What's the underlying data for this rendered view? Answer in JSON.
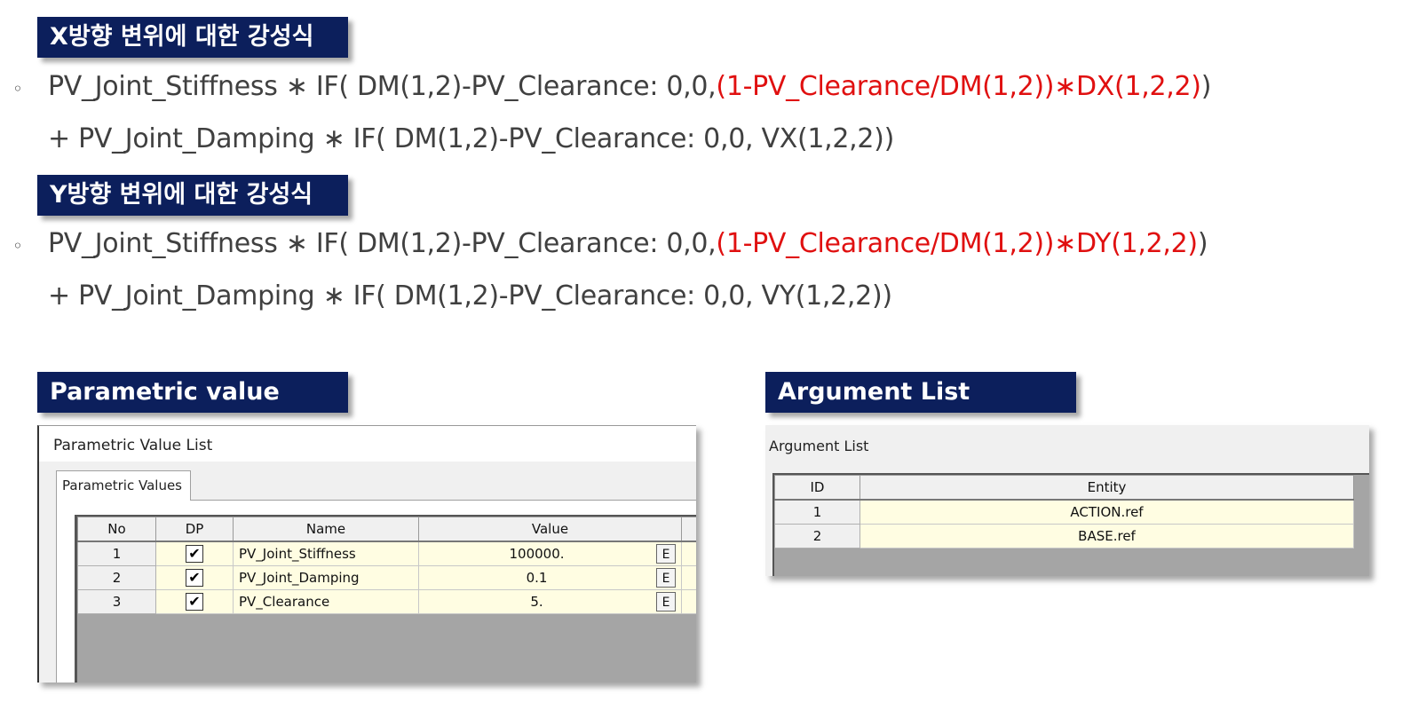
{
  "sections": {
    "x_header": "X방향 변위에 대한 강성식",
    "y_header": "Y방향 변위에 대한 강성식",
    "param_header": "Parametric value",
    "arg_header": "Argument List"
  },
  "equations": {
    "bullet": "◦",
    "x_line1_black": "PV_Joint_Stiffness ∗ IF( DM(1,2)-PV_Clearance: 0,0,",
    "x_line1_red": "(1-PV_Clearance/DM(1,2))∗DX(1,2,2)",
    "x_line1_end": ")",
    "x_line2": "+ PV_Joint_Damping ∗ IF( DM(1,2)-PV_Clearance: 0,0, VX(1,2,2))",
    "y_line1_black": "PV_Joint_Stiffness ∗ IF( DM(1,2)-PV_Clearance: 0,0,",
    "y_line1_red": "(1-PV_Clearance/DM(1,2))∗DY(1,2,2)",
    "y_line1_end": ")",
    "y_line2": "+ PV_Joint_Damping ∗ IF( DM(1,2)-PV_Clearance: 0,0, VY(1,2,2))",
    "highlight_color": "#e01010"
  },
  "param_dialog": {
    "title": "Parametric Value List",
    "tab": "Parametric Values",
    "columns": [
      "No",
      "DP",
      "Name",
      "Value"
    ],
    "rows": [
      {
        "no": "1",
        "dp": "✔",
        "name": "PV_Joint_Stiffness",
        "value": "100000.",
        "btn": "E"
      },
      {
        "no": "2",
        "dp": "✔",
        "name": "PV_Joint_Damping",
        "value": "0.1",
        "btn": "E"
      },
      {
        "no": "3",
        "dp": "✔",
        "name": "PV_Clearance",
        "value": "5.",
        "btn": "E"
      }
    ]
  },
  "arg_dialog": {
    "title": "Argument List",
    "columns": [
      "ID",
      "Entity"
    ],
    "rows": [
      {
        "id": "1",
        "entity": "ACTION.ref"
      },
      {
        "id": "2",
        "entity": "BASE.ref"
      }
    ]
  },
  "colors": {
    "header_bg": "#0c1f5c",
    "cell_bg": "#fffde2",
    "grid_empty_bg": "#a5a5a5"
  }
}
